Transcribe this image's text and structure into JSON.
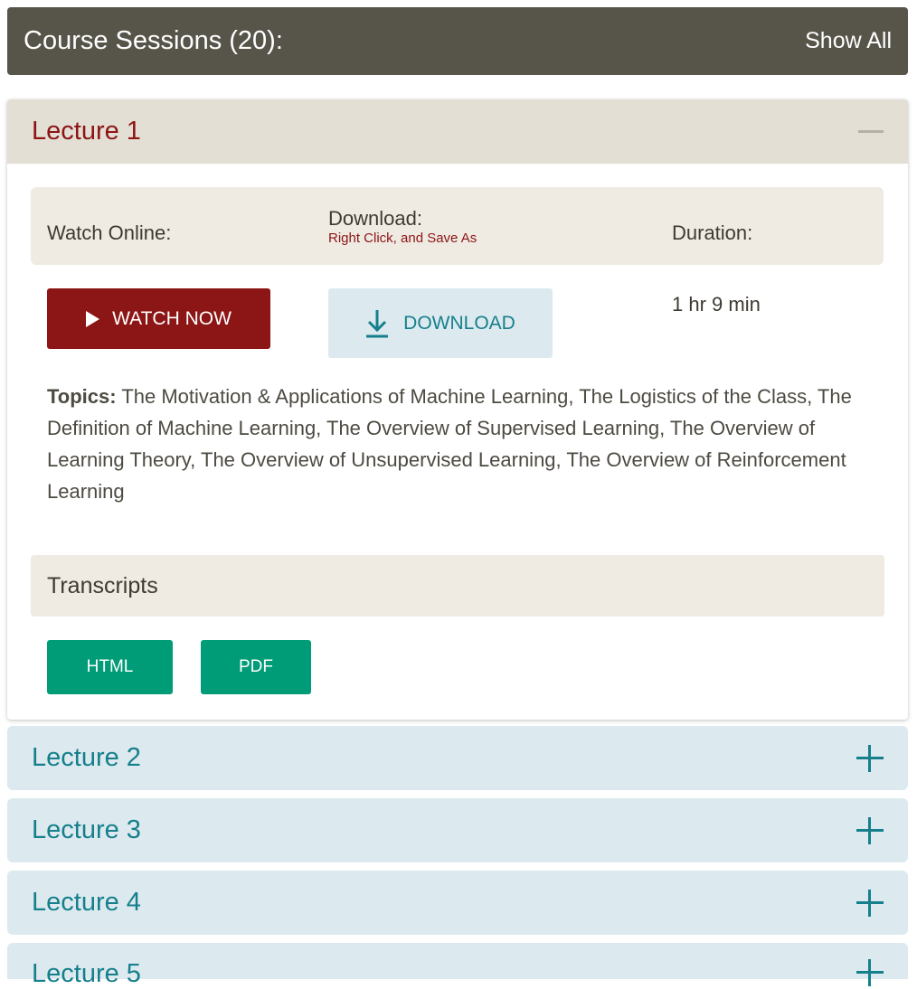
{
  "header": {
    "title": "Course Sessions (20):",
    "toggle_label": "Show All"
  },
  "open_lecture": {
    "title": "Lecture 1",
    "labels": {
      "watch_online": "Watch Online:",
      "download": "Download:",
      "download_hint": "Right Click, and Save As",
      "duration": "Duration:"
    },
    "watch_button": "WATCH NOW",
    "download_button": "DOWNLOAD",
    "duration_value": "1 hr 9 min",
    "topics_label": "Topics:",
    "topics_text": "The Motivation & Applications of Machine Learning, The Logistics of the Class, The Definition of Machine Learning, The Overview of Supervised Learning, The Overview of Learning Theory, The Overview of Unsupervised Learning, The Overview of Reinforcement Learning",
    "transcripts_heading": "Transcripts",
    "transcript_buttons": [
      "HTML",
      "PDF"
    ]
  },
  "collapsed_lectures": [
    {
      "title": "Lecture 2"
    },
    {
      "title": "Lecture 3"
    },
    {
      "title": "Lecture 4"
    },
    {
      "title": "Lecture 5"
    }
  ],
  "colors": {
    "header_bg": "#57554a",
    "accent_red": "#8c1515",
    "accent_teal": "#167f8c",
    "accent_green": "#009b77",
    "collapsed_bg": "#dceaef",
    "open_head_bg": "#e3dfd4"
  },
  "icons": {
    "play": "play-icon",
    "download": "download-arrow-icon",
    "collapse": "minus-icon",
    "expand": "plus-icon"
  }
}
